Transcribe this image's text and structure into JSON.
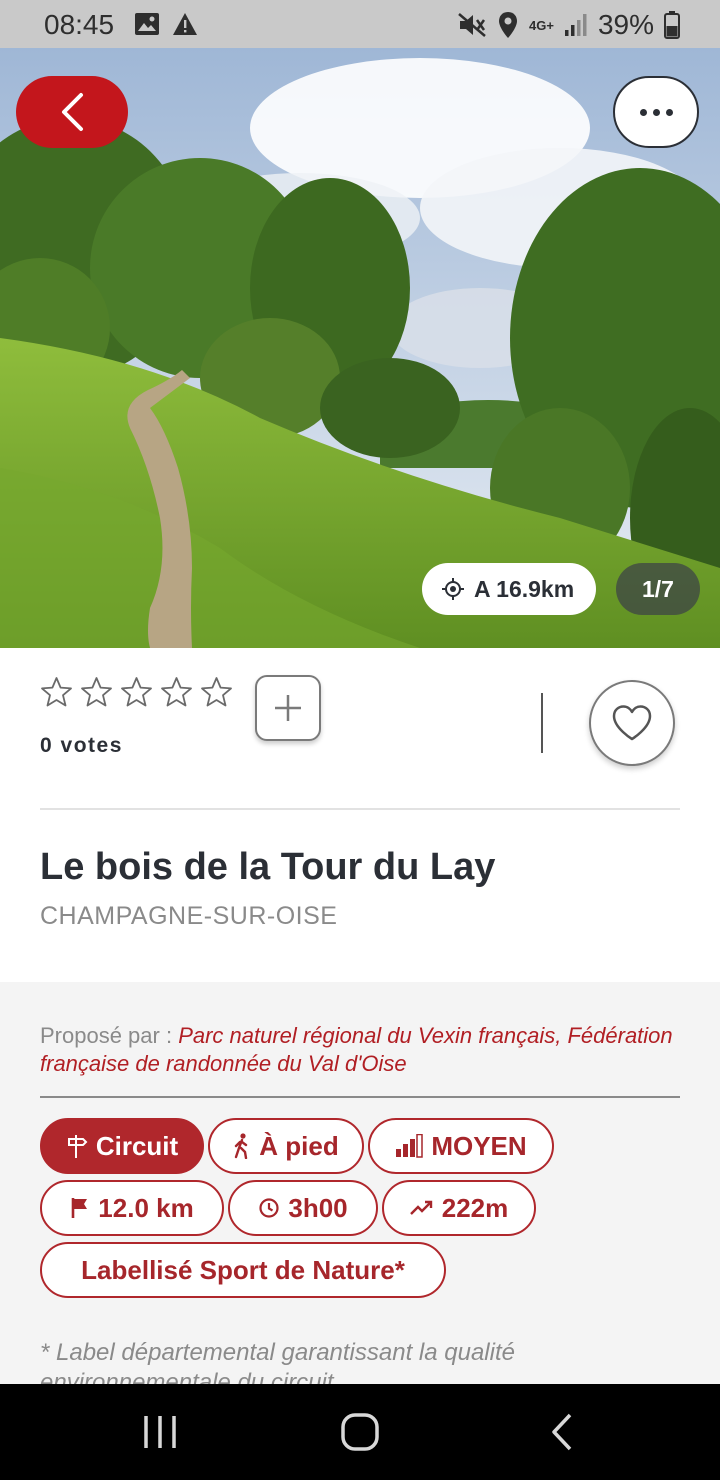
{
  "status_bar": {
    "time": "08:45",
    "battery": "39%",
    "network": "4G+",
    "icons": [
      "image-icon",
      "warning-icon",
      "mute-icon",
      "location-icon",
      "signal-icon",
      "battery-icon"
    ]
  },
  "hero": {
    "distance_label": "A 16.9km",
    "photo_counter": "1/7",
    "back_icon": "chevron-left-icon",
    "more_icon": "more-dots-icon"
  },
  "rating": {
    "stars_total": 5,
    "stars_filled": 0,
    "votes_label": "0 votes"
  },
  "route": {
    "title": "Le bois de la Tour du Lay",
    "location": "CHAMPAGNE-SUR-OISE",
    "proposed_label": "Proposé par : ",
    "proposed_value": "Parc naturel régional du Vexin français, Fédération française de randonnée du Val d'Oise",
    "tags": {
      "circuit": "Circuit",
      "mode": "À pied",
      "difficulty": "MOYEN",
      "distance": "12.0 km",
      "duration": "3h00",
      "elevation": "222m",
      "label": "Labellisé Sport de Nature*"
    },
    "footnote": "* Label départemental garantissant la qualité environnementale du circuit"
  },
  "colors": {
    "brand_red": "#c3161c",
    "tag_red": "#b0272c",
    "status_bar_bg": "#c9c9c9"
  }
}
